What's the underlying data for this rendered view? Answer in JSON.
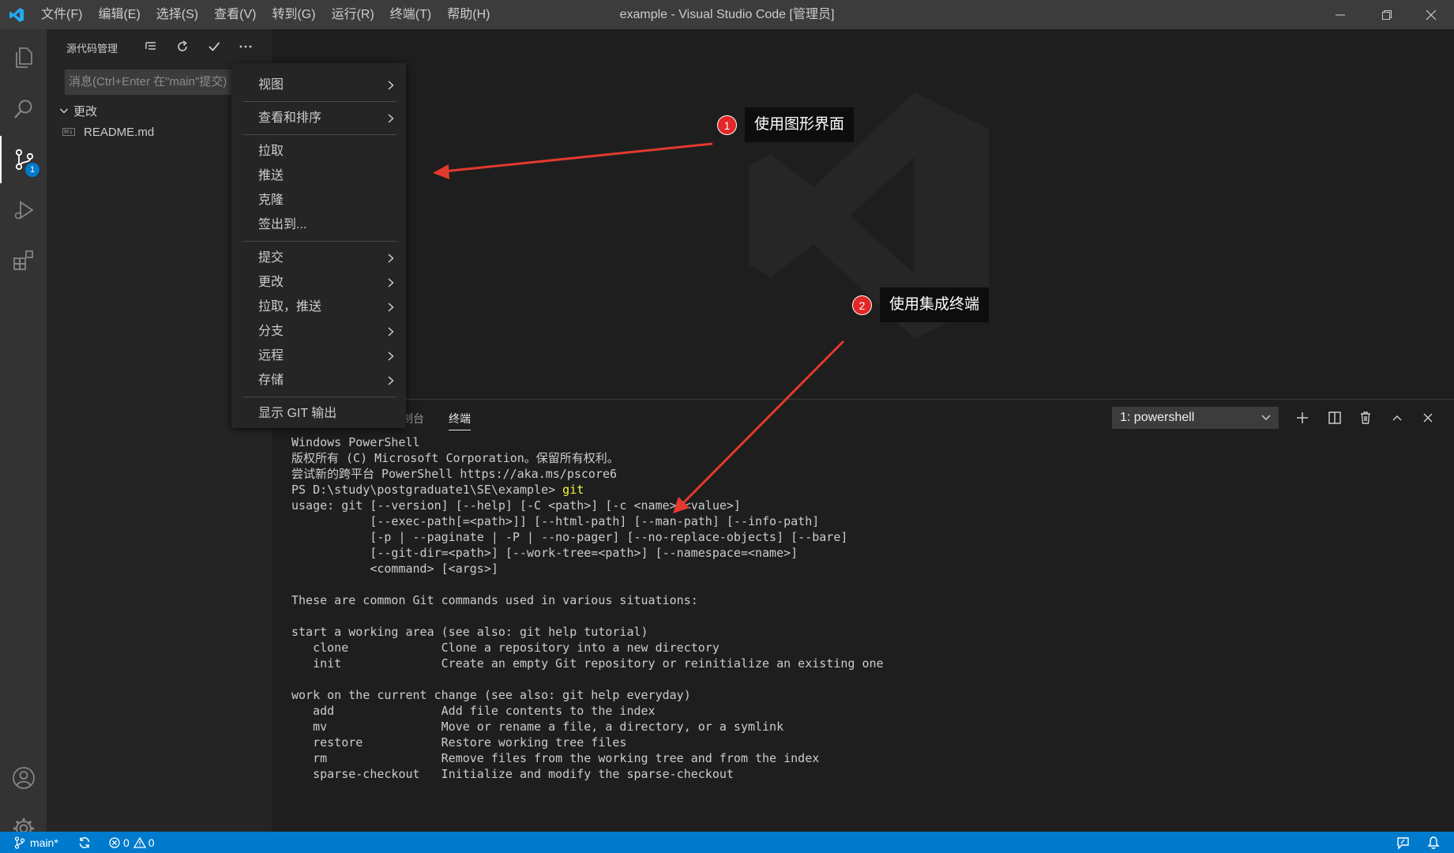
{
  "window": {
    "title": "example - Visual Studio Code [管理员]"
  },
  "menubar": [
    "文件(F)",
    "编辑(E)",
    "选择(S)",
    "查看(V)",
    "转到(G)",
    "运行(R)",
    "终端(T)",
    "帮助(H)"
  ],
  "activity": {
    "scm_badge": "1"
  },
  "sidebar": {
    "title": "源代码管理",
    "commit_placeholder": "消息(Ctrl+Enter 在\"main\"提交)",
    "changes_header": "更改",
    "files": [
      "README.md"
    ],
    "file_icon_text": "M↓"
  },
  "context_menu": {
    "items": [
      {
        "label": "视图",
        "submenu": true
      },
      {
        "label": "查看和排序",
        "submenu": true
      },
      {
        "label": "拉取",
        "submenu": false
      },
      {
        "label": "推送",
        "submenu": false
      },
      {
        "label": "克隆",
        "submenu": false
      },
      {
        "label": "签出到...",
        "submenu": false
      },
      {
        "label": "提交",
        "submenu": true
      },
      {
        "label": "更改",
        "submenu": true
      },
      {
        "label": "拉取，推送",
        "submenu": true
      },
      {
        "label": "分支",
        "submenu": true
      },
      {
        "label": "远程",
        "submenu": true
      },
      {
        "label": "存储",
        "submenu": true
      },
      {
        "label": "显示 GIT 输出",
        "submenu": false
      }
    ]
  },
  "annotations": [
    {
      "number": "1",
      "text": "使用图形界面"
    },
    {
      "number": "2",
      "text": "使用集成终端"
    }
  ],
  "panel": {
    "tabs": [
      "制台",
      "终端"
    ],
    "active_tab": "终端",
    "terminal_select": "1: powershell",
    "terminal": {
      "lines_before_cmd": [
        "Windows PowerShell",
        "版权所有 (C) Microsoft Corporation。保留所有权利。",
        "",
        "尝试新的跨平台 PowerShell https://aka.ms/pscore6",
        ""
      ],
      "prompt": "PS D:\\study\\postgraduate1\\SE\\example> ",
      "command": "git",
      "output": [
        "usage: git [--version] [--help] [-C <path>] [-c <name>=<value>]",
        "           [--exec-path[=<path>]] [--html-path] [--man-path] [--info-path]",
        "           [-p | --paginate | -P | --no-pager] [--no-replace-objects] [--bare]",
        "           [--git-dir=<path>] [--work-tree=<path>] [--namespace=<name>]",
        "           <command> [<args>]",
        "",
        "These are common Git commands used in various situations:",
        "",
        "start a working area (see also: git help tutorial)",
        "   clone             Clone a repository into a new directory",
        "   init              Create an empty Git repository or reinitialize an existing one",
        "",
        "work on the current change (see also: git help everyday)",
        "   add               Add file contents to the index",
        "   mv                Move or rename a file, a directory, or a symlink",
        "   restore           Restore working tree files",
        "   rm                Remove files from the working tree and from the index",
        "   sparse-checkout   Initialize and modify the sparse-checkout"
      ]
    }
  },
  "statusbar": {
    "branch": "main*",
    "errors": "0",
    "warnings": "0"
  },
  "colors": {
    "accent": "#007acc",
    "annotation": "#e12727",
    "command": "#f5f543"
  }
}
